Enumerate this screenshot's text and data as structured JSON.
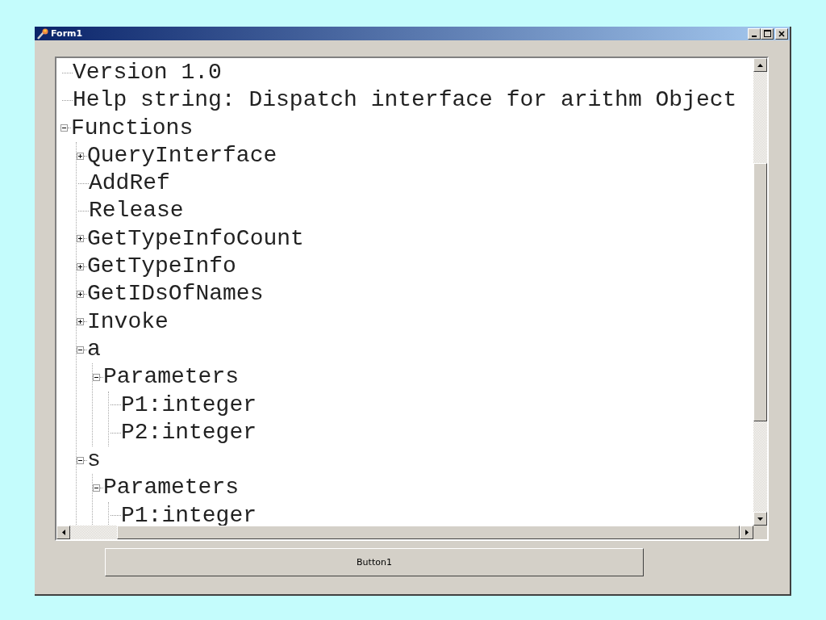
{
  "window": {
    "title": "Form1"
  },
  "tree": {
    "items": [
      {
        "label": "Version 1.0",
        "kind": "leaf"
      },
      {
        "label": "Help string: Dispatch interface for arithm Object",
        "kind": "leaf"
      },
      {
        "label": "Functions",
        "kind": "branch",
        "expanded": true,
        "children": [
          {
            "label": "QueryInterface",
            "kind": "branch",
            "expanded": false
          },
          {
            "label": "AddRef",
            "kind": "leaf"
          },
          {
            "label": "Release",
            "kind": "leaf"
          },
          {
            "label": "GetTypeInfoCount",
            "kind": "branch",
            "expanded": false
          },
          {
            "label": "GetTypeInfo",
            "kind": "branch",
            "expanded": false
          },
          {
            "label": "GetIDsOfNames",
            "kind": "branch",
            "expanded": false
          },
          {
            "label": "Invoke",
            "kind": "branch",
            "expanded": false
          },
          {
            "label": "a",
            "kind": "branch",
            "expanded": true,
            "children": [
              {
                "label": "Parameters",
                "kind": "branch",
                "expanded": true,
                "children": [
                  {
                    "label": "P1:integer",
                    "kind": "leaf"
                  },
                  {
                    "label": "P2:integer",
                    "kind": "leaf"
                  }
                ]
              }
            ]
          },
          {
            "label": "s",
            "kind": "branch",
            "expanded": true,
            "children": [
              {
                "label": "Parameters",
                "kind": "branch",
                "expanded": true,
                "children": [
                  {
                    "label": "P1:integer",
                    "kind": "leaf"
                  }
                ]
              }
            ]
          }
        ]
      }
    ]
  },
  "button": {
    "label": "Button1"
  }
}
